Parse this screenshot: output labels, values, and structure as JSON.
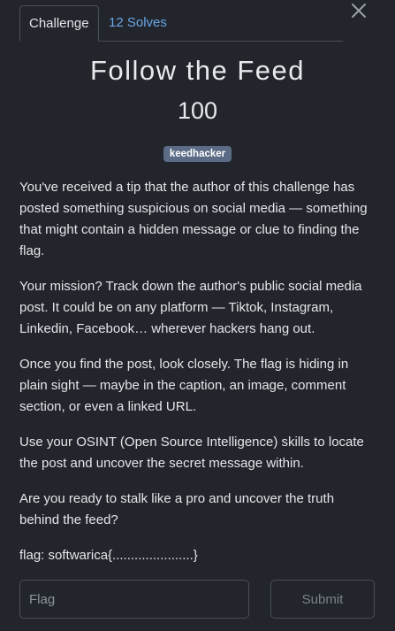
{
  "tabs": {
    "challenge_label": "Challenge",
    "solves_label": "12 Solves"
  },
  "challenge": {
    "title": "Follow the Feed",
    "points": "100",
    "tag": "keedhacker",
    "description": [
      "You've received a tip that the author of this challenge has posted something suspicious on social media — something that might contain a hidden message or clue to finding the flag.",
      "Your mission? Track down the author's public social media post. It could be on any platform — Tiktok, Instagram, Linkedin, Facebook… wherever hackers hang out.",
      "Once you find the post, look closely. The flag is hiding in plain sight — maybe in the caption, an image, comment section, or even a linked URL.",
      "Use your OSINT (Open Source Intelligence) skills to locate the post and uncover the secret message within.",
      "Are you ready to stalk like a pro and uncover the truth behind the feed?",
      "flag: softwarica{......................}"
    ]
  },
  "form": {
    "flag_placeholder": "Flag",
    "flag_value": "",
    "submit_label": "Submit"
  },
  "icons": {
    "close": "close-icon"
  },
  "colors": {
    "background": "#22252b",
    "link": "#6aa6e8",
    "tag_bg": "#5b6b85"
  }
}
